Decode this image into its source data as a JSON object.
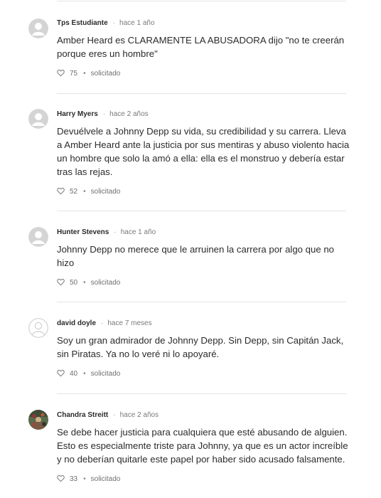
{
  "comments": [
    {
      "author": "Tps Estudiante",
      "time": "hace 1 año",
      "text": "Amber Heard es CLARAMENTE LA ABUSADORA dijo \"no te creerán porque eres un hombre\"",
      "likes": "75",
      "status": "solicitado",
      "avatar": "default"
    },
    {
      "author": "Harry Myers",
      "time": "hace 2 años",
      "text": "Devuélvele a Johnny Depp su vida, su credibilidad y su carrera. Lleva a Amber Heard ante la justicia por sus mentiras y abuso violento hacia un hombre que solo la amó a ella: ella es el monstruo y debería estar tras las rejas.",
      "likes": "52",
      "status": "solicitado",
      "avatar": "default"
    },
    {
      "author": "Hunter Stevens",
      "time": "hace 1 año",
      "text": "Johnny Depp no merece que le arruinen la carrera por algo que no hizo",
      "likes": "50",
      "status": "solicitado",
      "avatar": "default"
    },
    {
      "author": "david doyle",
      "time": "hace 7 meses",
      "text": "Soy un gran admirador de Johnny Depp. Sin Depp, sin Capitán Jack, sin Piratas. Ya no lo veré ni lo apoyaré.",
      "likes": "40",
      "status": "solicitado",
      "avatar": "outline"
    },
    {
      "author": "Chandra Streitt",
      "time": "hace 2 años",
      "text": "Se debe hacer justicia para cualquiera que esté abusando de alguien. Esto es especialmente triste para Johnny, ya que es un actor increíble y no deberían quitarle este papel por haber sido acusado falsamente.",
      "likes": "33",
      "status": "solicitado",
      "avatar": "photo"
    }
  ],
  "icons": {
    "like": "heart-icon",
    "avatar_default": "user-avatar-icon",
    "avatar_photo": "profile-photo"
  },
  "colors": {
    "text": "#2b2b2b",
    "meta": "#7a7a7a",
    "divider": "#e4e4e4",
    "avatar_gray": "#c8c8c8"
  }
}
